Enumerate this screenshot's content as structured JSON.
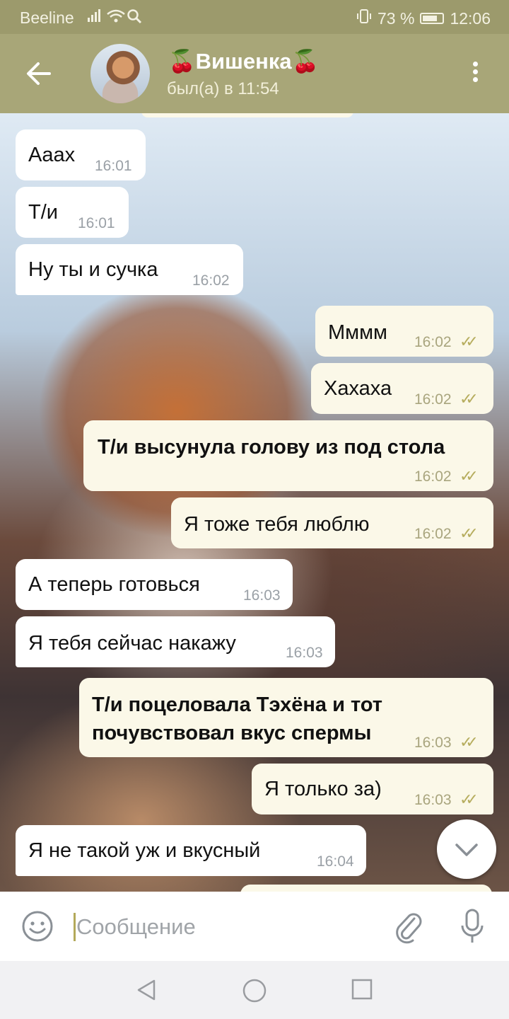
{
  "status_bar": {
    "carrier": "Beeline",
    "battery": "73 %",
    "time": "12:06"
  },
  "header": {
    "title": "🍒Вишенка🍒",
    "subtitle": "был(а) в 11:54",
    "back_icon": "arrow-left-icon",
    "menu_icon": "more-vert-icon"
  },
  "messages": [
    {
      "direction": "in",
      "text": "Аaах",
      "time": "16:01"
    },
    {
      "direction": "in",
      "text": "Т/и",
      "time": "16:01"
    },
    {
      "direction": "in",
      "text": "Ну ты и сучка",
      "time": "16:02"
    },
    {
      "direction": "out",
      "text": "Мммм",
      "time": "16:02",
      "read": true
    },
    {
      "direction": "out",
      "text": "Хахаха",
      "time": "16:02",
      "read": true
    },
    {
      "direction": "out",
      "text": "Т/и высунула голову из под стола",
      "time": "16:02",
      "read": true
    },
    {
      "direction": "out",
      "text": "Я тоже тебя люблю",
      "time": "16:02",
      "read": true
    },
    {
      "direction": "in",
      "text": "А теперь готовься",
      "time": "16:03"
    },
    {
      "direction": "in",
      "text": "Я тебя сейчас накажу",
      "time": "16:03"
    },
    {
      "direction": "out",
      "text_line1": "Т/и поцеловала Тэхёна и тот",
      "text_line2": "почувствовал вкус спермы",
      "time": "16:03",
      "read": true
    },
    {
      "direction": "out",
      "text": "Я только за)",
      "time": "16:03",
      "read": true
    },
    {
      "direction": "in",
      "text": "Я не такой уж и вкусный",
      "time": "16:04"
    }
  ],
  "composer": {
    "placeholder": "Сообщение"
  },
  "colors": {
    "bar": "#a8a678",
    "status": "#9c9a6c",
    "outgoing": "#fbf8e8",
    "ticks": "#b6ad5e"
  }
}
